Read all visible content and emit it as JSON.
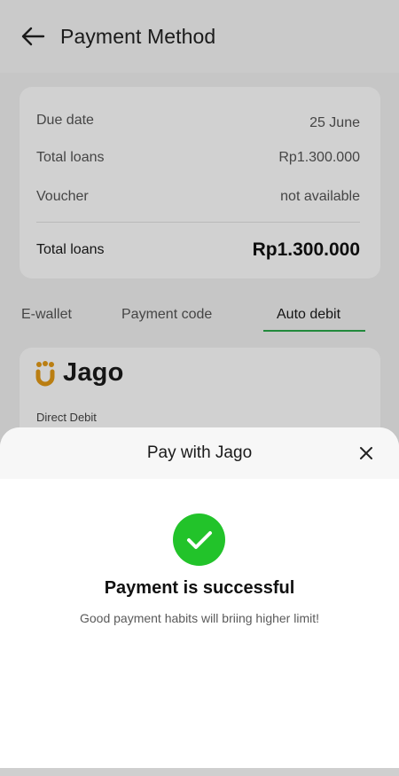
{
  "header": {
    "title": "Payment Method"
  },
  "summary": {
    "rows": [
      {
        "label": "Due date",
        "value": "25 June"
      },
      {
        "label": "Total loans",
        "value": "Rp1.300.000"
      },
      {
        "label": "Voucher",
        "value": "not available"
      }
    ],
    "total": {
      "label": "Total loans",
      "value": "Rp1.300.000"
    }
  },
  "tabs": [
    {
      "label": "E-wallet"
    },
    {
      "label": "Payment code"
    },
    {
      "label": "Auto debit",
      "active": true
    }
  ],
  "bank": {
    "name": "Jago",
    "subtitle": "Direct Debit",
    "logo_color": "#e39a16"
  },
  "sheet": {
    "title": "Pay with Jago",
    "success_title": "Payment is successful",
    "success_message": "Good payment habits will briing higher limit!",
    "success_color": "#22c32a"
  },
  "icons": {
    "back": "arrow-left-icon",
    "close": "close-icon",
    "success": "check-circle-icon",
    "bank_logo": "jago-logo-icon"
  },
  "colors": {
    "accent_tab": "#2aa84a"
  }
}
